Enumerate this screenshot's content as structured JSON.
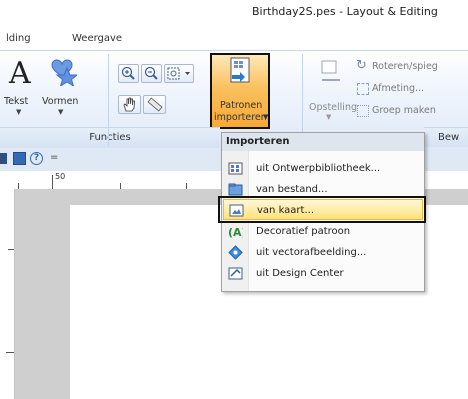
{
  "window": {
    "title": "Birthday2S.pes - Layout & Editing"
  },
  "ribbon_tabs": [
    {
      "label": "lding"
    },
    {
      "label": "Weergave"
    }
  ],
  "ribbon": {
    "tekst_label": "Tekst",
    "vormen_label": "Vormen",
    "patronen_line1": "Patronen",
    "patronen_line2": "importeren",
    "opstelling_label": "Opstelling",
    "roteren_label": "Roteren/spieg",
    "afmeting_label": "Afmeting...",
    "groep_label": "Groep maken",
    "functies_label": "Functies",
    "bew_label": "Bew"
  },
  "ruler": {
    "mark_50": "50"
  },
  "import_menu": {
    "header": "Importeren",
    "items": [
      {
        "label": "uit Ontwerpbibliotheek...",
        "icon": "library-icon"
      },
      {
        "label": "van bestand...",
        "icon": "folder-icon"
      },
      {
        "label": "van kaart...",
        "icon": "card-icon",
        "highlighted": true
      },
      {
        "label": "Decoratief patroon",
        "icon": "decorative-pattern-icon"
      },
      {
        "label": "uit vectorafbeelding...",
        "icon": "vector-image-icon"
      },
      {
        "label": "uit Design Center",
        "icon": "design-center-icon"
      }
    ]
  },
  "colors": {
    "highlight": "#ffe27a",
    "accent_orange": "#f7a835",
    "ribbon_bg": "#eaf1fb"
  }
}
